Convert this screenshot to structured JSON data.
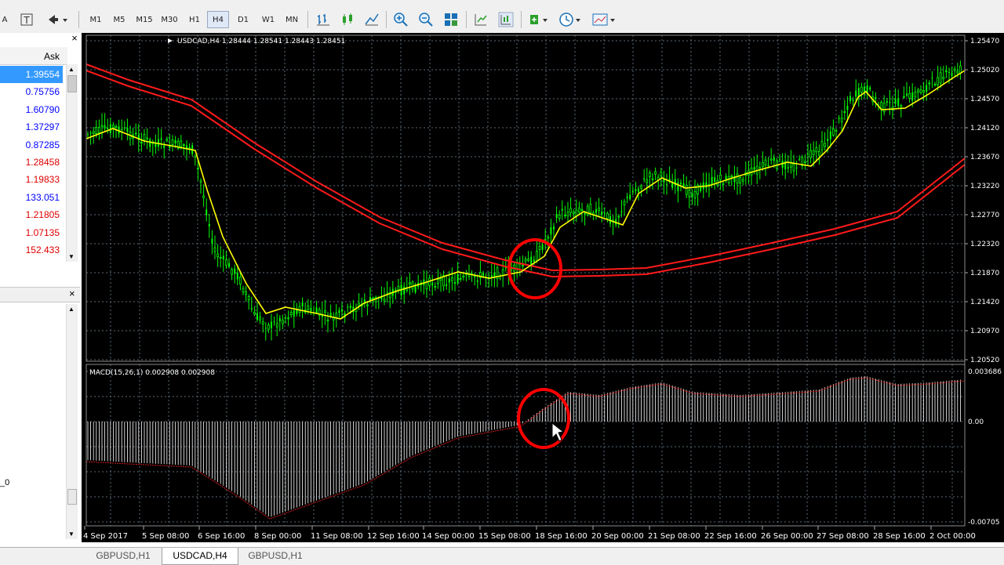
{
  "toolbar": {
    "left_glyph": "A",
    "timeframes": [
      "M1",
      "M5",
      "M15",
      "M30",
      "H1",
      "H4",
      "D1",
      "W1",
      "MN"
    ],
    "active_timeframe": "H4"
  },
  "market_watch": {
    "column_header": "Ask",
    "prices": [
      {
        "value": "1.39554",
        "color": "#0000ff",
        "selected": true
      },
      {
        "value": "0.75756",
        "color": "#0000ff"
      },
      {
        "value": "1.60790",
        "color": "#0000ff"
      },
      {
        "value": "1.37297",
        "color": "#0000ff"
      },
      {
        "value": "0.87285",
        "color": "#0000ff"
      },
      {
        "value": "1.28458",
        "color": "#dd0000"
      },
      {
        "value": "1.19833",
        "color": "#dd0000"
      },
      {
        "value": "133.051",
        "color": "#0000ff"
      },
      {
        "value": "1.21805",
        "color": "#dd0000"
      },
      {
        "value": "1.07135",
        "color": "#dd0000"
      },
      {
        "value": "152.433",
        "color": "#dd0000"
      }
    ],
    "left_edge_label": "_0"
  },
  "chart": {
    "info": "USDCAD,H4  1.28444 1.28541 1.28443 1.28451",
    "price_axis": [
      "1.25470",
      "1.25020",
      "1.24570",
      "1.24120",
      "1.23670",
      "1.23220",
      "1.22770",
      "1.22320",
      "1.21870",
      "1.21420",
      "1.20970",
      "1.20520"
    ],
    "macd_info": "MACD(15,26,1) 0.002908 0.002908",
    "macd_axis": [
      "0.003686",
      "0.00",
      "-0.00705"
    ],
    "time_axis": [
      "4 Sep 2017",
      "5 Sep 08:00",
      "6 Sep 16:00",
      "8 Sep 00:00",
      "11 Sep 08:00",
      "12 Sep 16:00",
      "14 Sep 00:00",
      "15 Sep 08:00",
      "18 Sep 16:00",
      "20 Sep 00:00",
      "21 Sep 08:00",
      "22 Sep 16:00",
      "26 Sep 00:00",
      "27 Sep 08:00",
      "28 Sep 16:00",
      "2 Oct 00:00"
    ],
    "colors": {
      "candle": "#00ff00",
      "fast_ma": "#ffff00",
      "slow_ma": "#ff0000",
      "grid": "#5a6a78",
      "annotation": "#ff0000"
    }
  },
  "tabs": [
    {
      "label": "GBPUSD,H1",
      "active": false
    },
    {
      "label": "USDCAD,H4",
      "active": true
    },
    {
      "label": "GBPUSD,H1",
      "active": false
    }
  ]
}
